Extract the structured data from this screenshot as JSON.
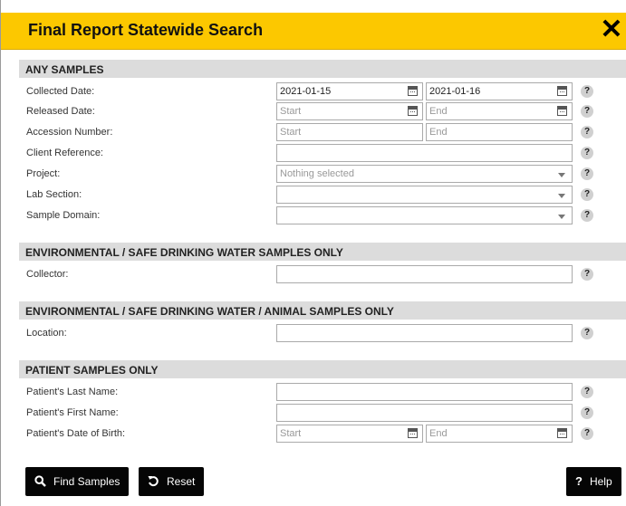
{
  "dialog": {
    "title": "Final Report Statewide Search",
    "close_glyph": "✕"
  },
  "sections": {
    "any": "ANY SAMPLES",
    "env": "ENVIRONMENTAL / SAFE DRINKING WATER SAMPLES ONLY",
    "env_animal": "ENVIRONMENTAL / SAFE DRINKING WATER / ANIMAL SAMPLES ONLY",
    "patient": "PATIENT SAMPLES ONLY"
  },
  "fields": {
    "collected_date": {
      "label": "Collected Date:",
      "start": "2021-01-15",
      "end": "2021-01-16"
    },
    "released_date": {
      "label": "Released Date:",
      "start_placeholder": "Start",
      "end_placeholder": "End"
    },
    "accession_number": {
      "label": "Accession Number:",
      "start_placeholder": "Start",
      "end_placeholder": "End"
    },
    "client_reference": {
      "label": "Client Reference:",
      "value": ""
    },
    "project": {
      "label": "Project:",
      "selected": "Nothing selected"
    },
    "lab_section": {
      "label": "Lab Section:",
      "selected": ""
    },
    "sample_domain": {
      "label": "Sample Domain:",
      "selected": ""
    },
    "collector": {
      "label": "Collector:",
      "value": ""
    },
    "location": {
      "label": "Location:",
      "value": ""
    },
    "patient_last": {
      "label": "Patient's Last Name:",
      "value": ""
    },
    "patient_first": {
      "label": "Patient's First Name:",
      "value": ""
    },
    "patient_dob": {
      "label": "Patient's Date of Birth:",
      "start_placeholder": "Start",
      "end_placeholder": "End"
    }
  },
  "help_glyph": "?",
  "buttons": {
    "find": {
      "label": "Find Samples",
      "icon": "search-icon"
    },
    "reset": {
      "label": "Reset",
      "icon": "reset-icon"
    },
    "help": {
      "label": "Help",
      "icon": "question-icon"
    }
  },
  "colors": {
    "title_bar": "#fcc800",
    "section_bg": "#dcdcdc",
    "button_bg": "#050505"
  }
}
